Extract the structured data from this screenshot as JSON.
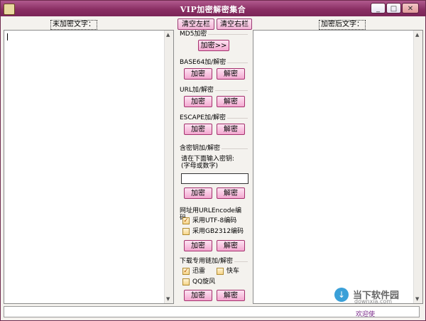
{
  "window": {
    "title": "VIP加密解密集合",
    "controls": {
      "minimize": "_",
      "maximize": "□",
      "close": "✕"
    }
  },
  "top": {
    "left_label": "未加密文字：",
    "right_label": "加密后文字：",
    "clear_left": "清空左栏",
    "clear_right": "清空右栏"
  },
  "md5": {
    "title": "MD5加密",
    "encrypt": "加密>>"
  },
  "base64": {
    "title": "BASE64加/解密",
    "encrypt": "加密",
    "decrypt": "解密"
  },
  "url": {
    "title": "URL加/解密",
    "encrypt": "加密",
    "decrypt": "解密"
  },
  "escape": {
    "title": "ESCAPE加/解密",
    "encrypt": "加密",
    "decrypt": "解密"
  },
  "key": {
    "title": "含密钥加/解密",
    "note1": "请在下面输入密钥:",
    "note2": "(字母或数字)",
    "value": "",
    "encrypt": "加密",
    "decrypt": "解密"
  },
  "urlencode": {
    "title": "网址用URLEncode编码",
    "opt1": "采用UTF-8编码",
    "opt1_checked": true,
    "opt2": "采用GB2312编码",
    "opt2_checked": false,
    "encrypt": "加密",
    "decrypt": "解密"
  },
  "download": {
    "title": "下载专用链加/解密",
    "opt1": "迅雷",
    "opt1_checked": true,
    "opt2": "快车",
    "opt2_checked": false,
    "opt3": "QQ旋风",
    "opt3_checked": false,
    "encrypt": "加密",
    "decrypt": "解密"
  },
  "status": {
    "text": "欢迎使"
  },
  "watermark": {
    "text": "当下软件园",
    "sub": "downxia.com"
  },
  "colors": {
    "title_bar": "#8a2f64",
    "button_pink": "#f3a8d0"
  }
}
